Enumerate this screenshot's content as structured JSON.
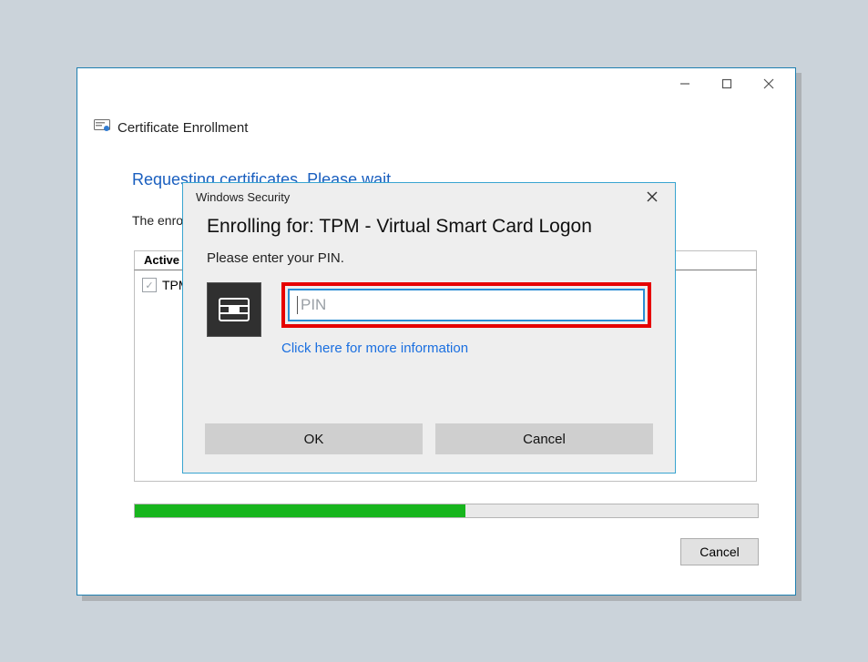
{
  "wizard": {
    "label": "Certificate Enrollment",
    "heading": "Requesting certificates. Please wait...",
    "subline_prefix": "The enro",
    "column_header": "Active",
    "row_prefix": "TPM",
    "progress_percent": 53,
    "cancel_label": "Cancel"
  },
  "modal": {
    "titlebar": "Windows Security",
    "heading": "Enrolling for: TPM - Virtual Smart Card Logon",
    "instruction": "Please enter your PIN.",
    "pin_placeholder": "PIN",
    "more_info": "Click here for more information",
    "ok_label": "OK",
    "cancel_label": "Cancel"
  }
}
